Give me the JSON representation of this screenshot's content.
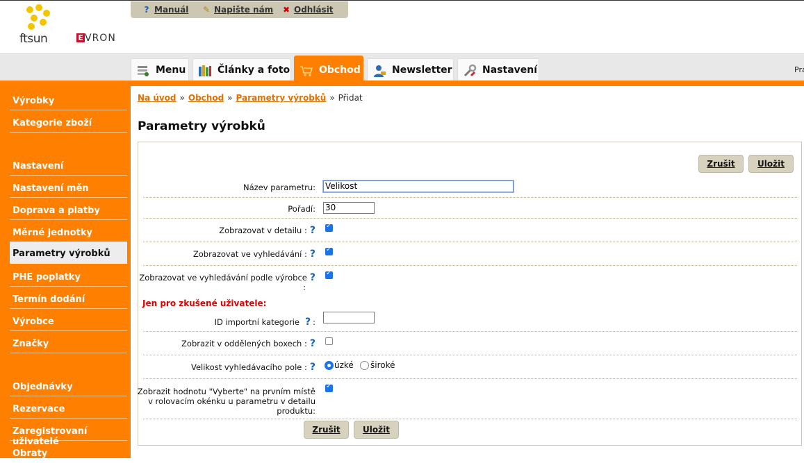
{
  "header": {
    "logo_ftsun": "ftsun",
    "logo_evron_e": "E",
    "logo_evron_rest": "VRON",
    "top_links": [
      {
        "label": "Manuál",
        "icon": "help-icon"
      },
      {
        "label": "Napište nám",
        "icon": "pencil-icon"
      },
      {
        "label": "Odhlásit",
        "icon": "close-icon"
      }
    ],
    "tabs": [
      {
        "label": "Menu",
        "icon": "menu-stack-icon"
      },
      {
        "label": "Články a foto",
        "icon": "books-icon"
      },
      {
        "label": "Obchod",
        "icon": "cart-icon",
        "active": true
      },
      {
        "label": "Newsletter",
        "icon": "user-icon"
      },
      {
        "label": "Nastavení",
        "icon": "tools-icon"
      }
    ],
    "right_text": "Pra"
  },
  "sidebar": {
    "items": [
      "Výrobky",
      "Kategorie zboží",
      "Nastavení",
      "Nastavení měn",
      "Doprava a platby",
      "Měrné jednotky",
      "Parametry výrobků",
      "PHE poplatky",
      "Termín dodání",
      "Výrobce",
      "Značky",
      "Objednávky",
      "Rezervace",
      "Zaregistrovaní uživatelé",
      "Obraty"
    ],
    "active": "Parametry výrobků"
  },
  "breadcrumb": {
    "items": [
      "Na úvod",
      "Obchod",
      "Parametry výrobků"
    ],
    "separator": "»",
    "current": "Přidat"
  },
  "page_title": "Parametry výrobků",
  "form": {
    "cancel_label": "Zrušit",
    "save_label": "Uložit",
    "name_label": "Název parametru:",
    "name_value": "Velikost",
    "order_label": "Pořadí:",
    "order_value": "30",
    "show_detail_label": "Zobrazovat v detailu :",
    "show_detail_checked": true,
    "show_search_label": "Zobrazovat ve vyhledávání :",
    "show_search_checked": true,
    "show_search_manufacturer_label": "Zobrazovat ve vyhledávání podle výrobce",
    "show_search_manufacturer_colon": ":",
    "show_search_manufacturer_checked": true,
    "expert_note": "Jen pro zkušené uživatele:",
    "import_id_label": "ID importní kategorie",
    "import_id_colon": ":",
    "import_id_value": "",
    "separate_boxes_label": "Zobrazit v oddělených boxech :",
    "separate_boxes_checked": false,
    "search_field_size_label": "Velikost vyhledávacího pole :",
    "search_field_options": [
      "úzké",
      "široké"
    ],
    "search_field_selected": "úzké",
    "show_choose_label_lines": [
      "Zobrazit hodnotu \"Vyberte\" na prvním místě",
      "v rolovacím okénku u parametru v detailu",
      "produktu:"
    ],
    "show_choose_checked": true
  },
  "colors": {
    "accent_orange": "#ff7f00",
    "button_beige": "#d6d2be",
    "expert_red": "#e00000",
    "help_blue": "#1463b5"
  }
}
